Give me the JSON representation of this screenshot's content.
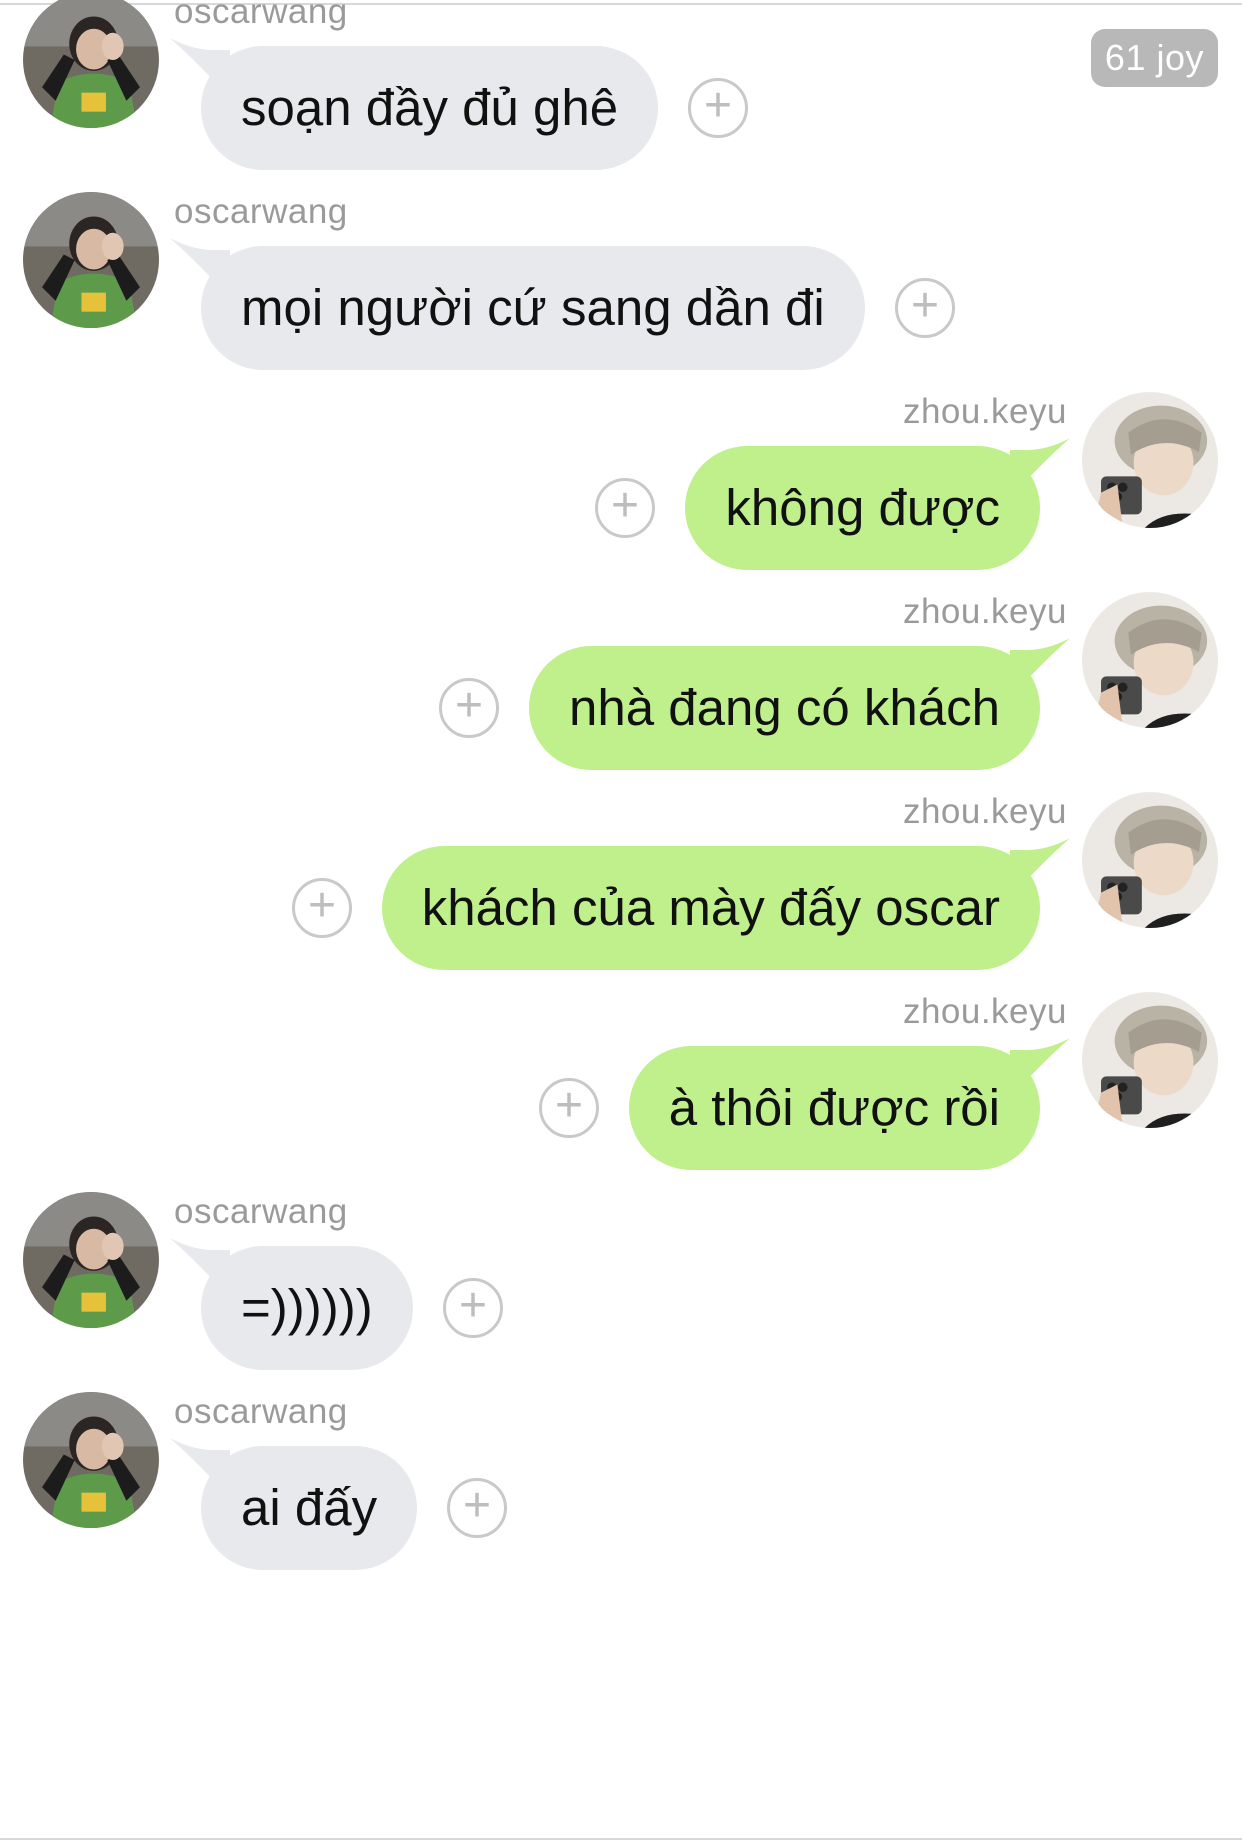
{
  "badge": {
    "text": "61 joy"
  },
  "messages": [
    {
      "side": "left",
      "sender": "oscarwang",
      "text": "soạn đầy đủ ghê"
    },
    {
      "side": "left",
      "sender": "oscarwang",
      "text": "mọi người cứ sang dần đi"
    },
    {
      "side": "right",
      "sender": "zhou.keyu",
      "text": "không được"
    },
    {
      "side": "right",
      "sender": "zhou.keyu",
      "text": "nhà đang có khách"
    },
    {
      "side": "right",
      "sender": "zhou.keyu",
      "text": "khách của mày đấy oscar"
    },
    {
      "side": "right",
      "sender": "zhou.keyu",
      "text": "à thôi được rồi"
    },
    {
      "side": "left",
      "sender": "oscarwang",
      "text": "=))))))"
    },
    {
      "side": "left",
      "sender": "oscarwang",
      "text": "ai đấy"
    }
  ],
  "icons": {
    "reaction": "add-reaction-icon",
    "avatar_left": "oscarwang-avatar",
    "avatar_right": "zhou-keyu-avatar"
  },
  "colors": {
    "incoming_bubble": "#e8e9ec",
    "outgoing_bubble": "#c0f08c",
    "sender_name": "#9a9a9a",
    "badge": "#b8b8b8"
  }
}
